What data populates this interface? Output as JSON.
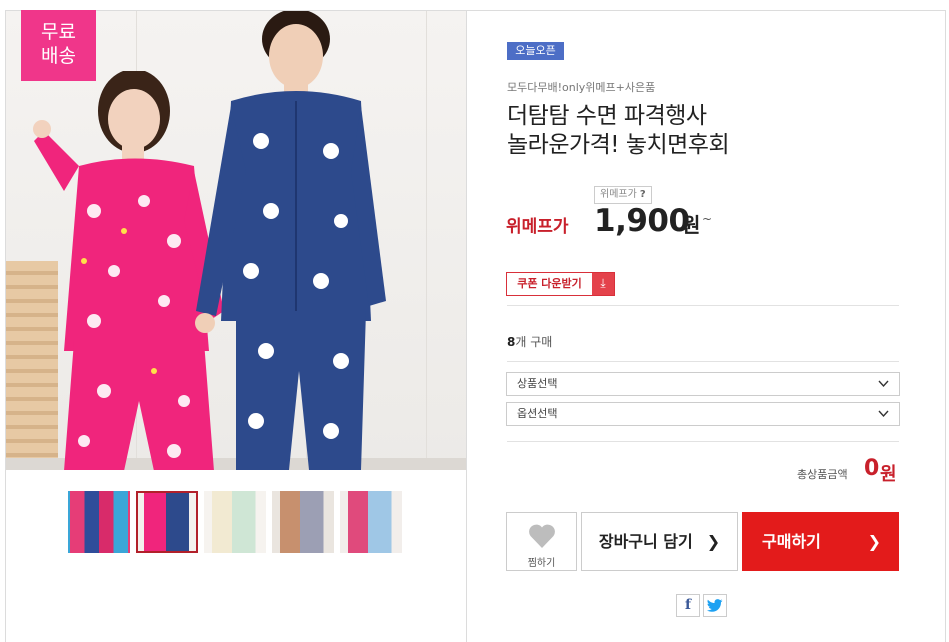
{
  "product": {
    "free_shipping_line1": "무료",
    "free_shipping_line2": "배송",
    "badge": "오늘오픈",
    "subtitle": "모두다무배!only위메프+사은품",
    "title_line1": "더탐탐 수면 파격행사",
    "title_line2": "놀라운가격! 놓치면후회",
    "price_tip": "위메프가",
    "price_tip_mark": "?",
    "price_label": "위메프가",
    "price": "1,900",
    "price_unit": "원",
    "price_suffix": "~",
    "coupon_label": "쿠폰 다운받기",
    "coupon_icon": "download-icon",
    "buy_count": "8",
    "buy_count_suffix": "개 구매",
    "product_select_placeholder": "상품선택",
    "option_select_placeholder": "옵션선택",
    "total_label": "총상품금액",
    "total_value": "0",
    "total_unit": "원"
  },
  "actions": {
    "wish_label": "찜하기",
    "cart_label": "장바구니 담기",
    "buy_label": "구매하기"
  },
  "share": {
    "facebook": "f",
    "twitter": "twitter-icon"
  },
  "colors": {
    "accent_red": "#e31b1b",
    "badge_pink": "#f0368a",
    "badge_blue": "#4d6ec6",
    "price_red": "#c8202b"
  },
  "thumbnails": [
    {
      "name": "thumb-1",
      "active": false
    },
    {
      "name": "thumb-2",
      "active": true
    },
    {
      "name": "thumb-3",
      "active": false
    },
    {
      "name": "thumb-4",
      "active": false
    },
    {
      "name": "thumb-5",
      "active": false
    }
  ]
}
